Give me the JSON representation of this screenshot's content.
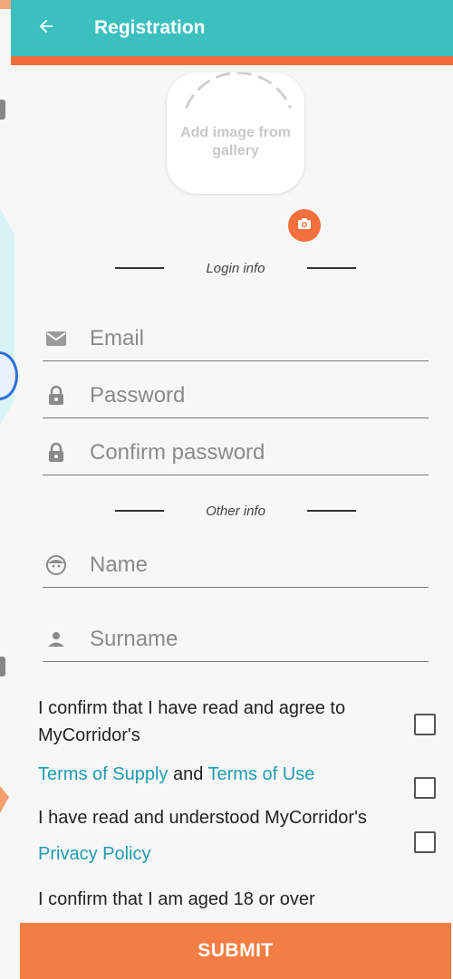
{
  "header": {
    "title": "Registration",
    "back_icon": "arrow-left-icon"
  },
  "avatar": {
    "label": "Add image from gallery",
    "camera_icon": "camera-icon"
  },
  "sections": {
    "login_info": "Login info",
    "other_info": "Other info"
  },
  "fields": {
    "email": {
      "placeholder": "Email",
      "value": "",
      "icon": "mail-icon"
    },
    "password": {
      "placeholder": "Password",
      "value": "",
      "icon": "lock-icon"
    },
    "confirm_password": {
      "placeholder": "Confirm password",
      "value": "",
      "icon": "lock-icon"
    },
    "name": {
      "placeholder": "Name",
      "value": "",
      "icon": "face-icon"
    },
    "surname": {
      "placeholder": "Surname",
      "value": "",
      "icon": "person-icon"
    }
  },
  "terms": {
    "agree_line1": "I confirm that I have read and agree to",
    "agree_line2": "MyCorridor's",
    "terms_of_supply": "Terms of Supply",
    "and": " and ",
    "terms_of_use": "Terms of Use",
    "privacy_line": "I have read and understood MyCorridor's",
    "privacy_policy": "Privacy Policy",
    "age_line": "I confirm that I am aged 18 or over",
    "checkboxes": [
      false,
      false,
      false
    ]
  },
  "submit_label": "SUBMIT",
  "colors": {
    "appbar": "#3cbfbf",
    "accent_orange": "#f26d3d",
    "link": "#1e9cb0",
    "submit": "#f27d45"
  }
}
